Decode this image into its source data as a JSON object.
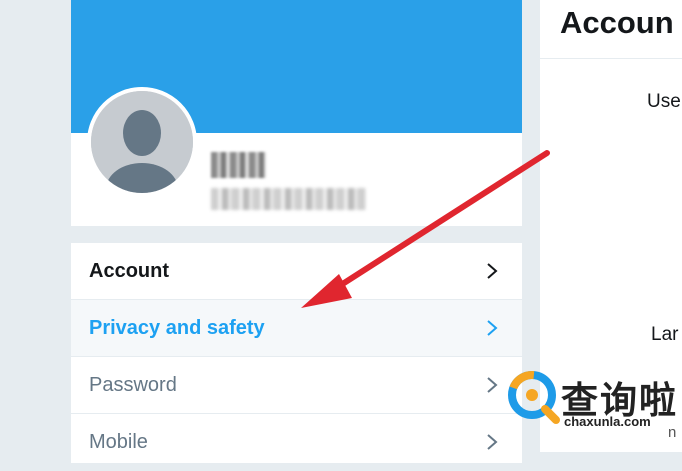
{
  "menu": {
    "items": [
      {
        "label": "Account"
      },
      {
        "label": "Privacy and safety"
      },
      {
        "label": "Password"
      },
      {
        "label": "Mobile"
      }
    ]
  },
  "right_panel": {
    "title": "Accoun",
    "username_label": "Use",
    "language_label": "Lar",
    "stray_char": "n"
  },
  "watermark": {
    "cn": "查询啦",
    "en": "chaxunla.com"
  },
  "colors": {
    "banner": "#2aa0e8",
    "active_link": "#1da1f2",
    "arrow": "#e0262f",
    "background": "#e6ecf0"
  }
}
